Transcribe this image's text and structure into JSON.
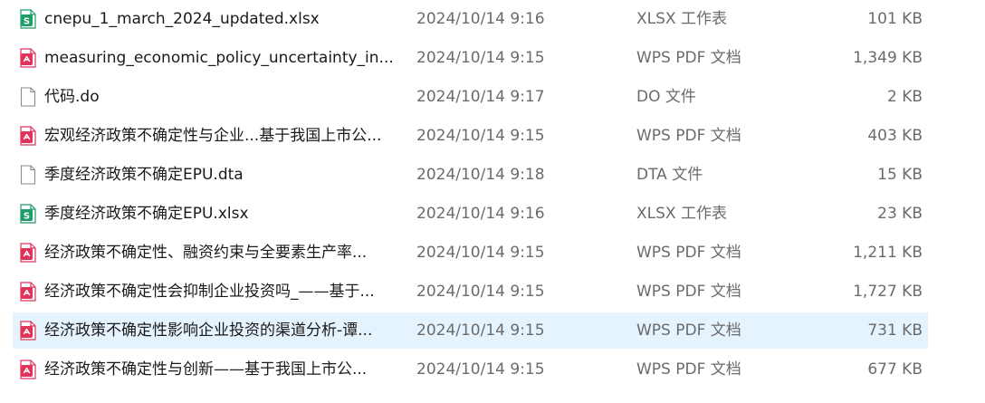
{
  "colors": {
    "xlsx_icon": "#1e9e6a",
    "pdf_icon": "#e0335a",
    "generic_icon_outline": "#8a8a8a",
    "selected_row_bg": "#e5f3ff",
    "secondary_text": "#6b6b6b"
  },
  "files": [
    {
      "name": "cnepu_1_march_2024_updated.xlsx",
      "modified": "2024/10/14 9:16",
      "type": "XLSX 工作表",
      "size": "101 KB",
      "icon": "xlsx-file-icon"
    },
    {
      "name": "measuring_economic_policy_uncertainty_in...",
      "modified": "2024/10/14 9:15",
      "type": "WPS PDF 文档",
      "size": "1,349 KB",
      "icon": "pdf-file-icon"
    },
    {
      "name": "代码.do",
      "modified": "2024/10/14 9:17",
      "type": "DO 文件",
      "size": "2 KB",
      "icon": "generic-file-icon"
    },
    {
      "name": "宏观经济政策不确定性与企业...基于我国上市公...",
      "modified": "2024/10/14 9:15",
      "type": "WPS PDF 文档",
      "size": "403 KB",
      "icon": "pdf-file-icon"
    },
    {
      "name": "季度经济政策不确定EPU.dta",
      "modified": "2024/10/14 9:18",
      "type": "DTA 文件",
      "size": "15 KB",
      "icon": "generic-file-icon"
    },
    {
      "name": "季度经济政策不确定EPU.xlsx",
      "modified": "2024/10/14 9:16",
      "type": "XLSX 工作表",
      "size": "23 KB",
      "icon": "xlsx-file-icon"
    },
    {
      "name": "经济政策不确定性、融资约束与全要素生产率...",
      "modified": "2024/10/14 9:15",
      "type": "WPS PDF 文档",
      "size": "1,211 KB",
      "icon": "pdf-file-icon"
    },
    {
      "name": "经济政策不确定性会抑制企业投资吗_——基于...",
      "modified": "2024/10/14 9:15",
      "type": "WPS PDF 文档",
      "size": "1,727 KB",
      "icon": "pdf-file-icon"
    },
    {
      "name": "经济政策不确定性影响企业投资的渠道分析-谭...",
      "modified": "2024/10/14 9:15",
      "type": "WPS PDF 文档",
      "size": "731 KB",
      "icon": "pdf-file-icon",
      "selected": true
    },
    {
      "name": "经济政策不确定性与创新——基于我国上市公...",
      "modified": "2024/10/14 9:15",
      "type": "WPS PDF 文档",
      "size": "677 KB",
      "icon": "pdf-file-icon"
    }
  ]
}
